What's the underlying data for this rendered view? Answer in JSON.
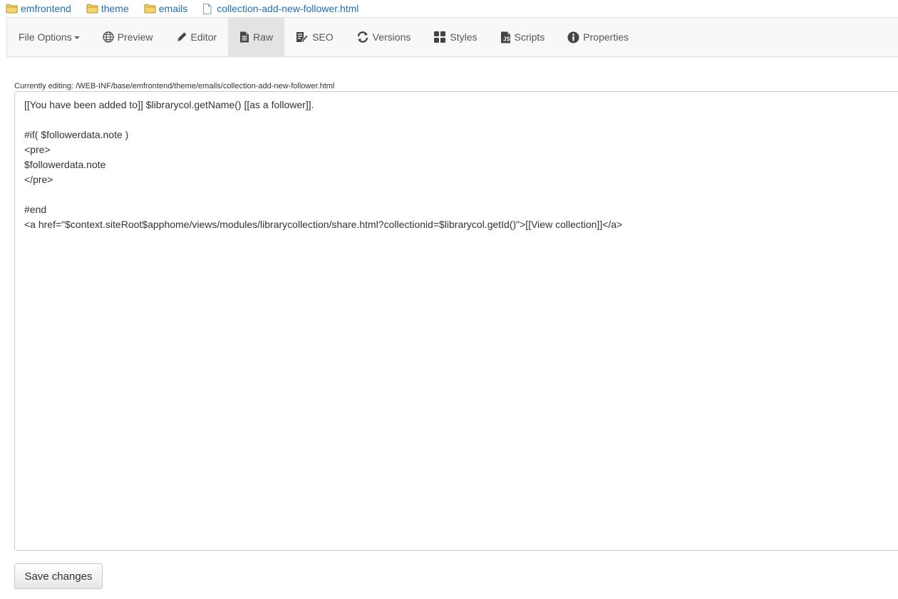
{
  "breadcrumb": [
    {
      "label": "emfrontend",
      "icon": "folder-icon"
    },
    {
      "label": "theme",
      "icon": "folder-icon"
    },
    {
      "label": "emails",
      "icon": "folder-icon"
    },
    {
      "label": "collection-add-new-follower.html",
      "icon": "file-icon"
    }
  ],
  "toolbar": {
    "file_options": "File Options",
    "preview": "Preview",
    "editor": "Editor",
    "raw": "Raw",
    "seo": "SEO",
    "versions": "Versions",
    "styles": "Styles",
    "scripts": "Scripts",
    "properties": "Properties",
    "active_tab": "Raw"
  },
  "editing": {
    "label": "Currently editing: /WEB-INF/base/emfrontend/theme/emails/collection-add-new-follower.html"
  },
  "editor": {
    "lines": [
      "[[You have been added to]] $librarycol.getName() [[as a follower]].",
      "",
      "#if( $followerdata.note )",
      "<pre>",
      "$followerdata.note",
      "</pre>",
      "",
      "#end",
      "<a href=\"$context.siteRoot$apphome/views/modules/librarycollection/share.html?collectionid=$librarycol.getId()\">[[View collection]]</a>"
    ]
  },
  "actions": {
    "save_label": "Save changes"
  },
  "colors": {
    "link": "#1f6eb5",
    "folder": "#e9c04a",
    "toolbar_bg": "#f8f8f8",
    "active_tab_bg": "#e3e3e3"
  }
}
